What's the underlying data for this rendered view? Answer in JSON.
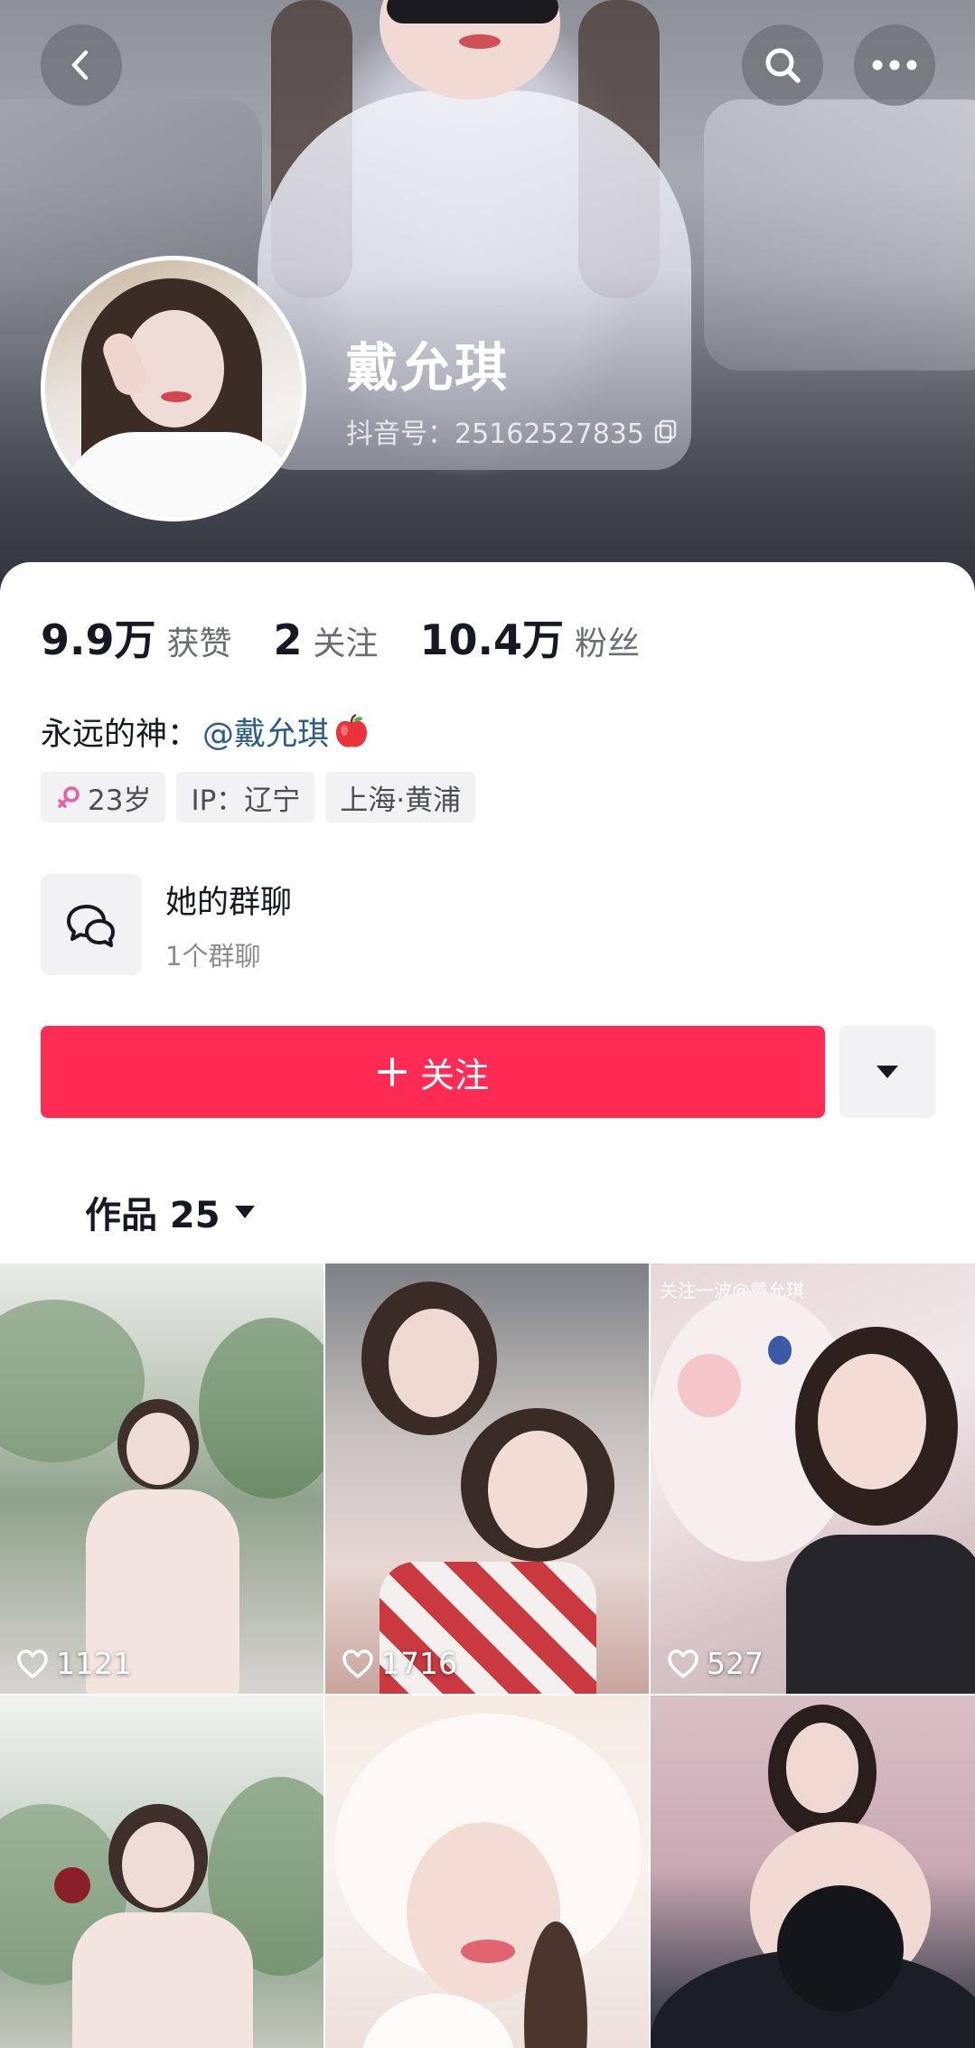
{
  "profile": {
    "name": "戴允琪",
    "douyin_id": "抖音号：25162527835"
  },
  "stats": [
    {
      "value": "9.9万",
      "label": "获赞"
    },
    {
      "value": "2",
      "label": "关注"
    },
    {
      "value": "10.4万",
      "label": "粉丝"
    }
  ],
  "bio": {
    "prefix": "永远的神：",
    "mention": "@戴允琪"
  },
  "tags": {
    "age": "23岁",
    "ip": "IP：辽宁",
    "location": "上海·黄浦"
  },
  "group_chat": {
    "title": "她的群聊",
    "subtitle": "1个群聊"
  },
  "follow_button": {
    "label": "关注"
  },
  "works_tab": {
    "label": "作品 25"
  },
  "videos": [
    {
      "likes": "1121"
    },
    {
      "likes": "1716"
    },
    {
      "likes": "527",
      "overlay_text": "关注一波@戴允琪"
    },
    {
      "likes": ""
    },
    {
      "likes": ""
    },
    {
      "likes": ""
    }
  ],
  "colors": {
    "follow_button": "#fe2c55",
    "link": "#2b5c8a",
    "gender_female": "#f05aa0"
  },
  "icons": [
    "back-icon",
    "search-icon",
    "more-icon",
    "copy-icon",
    "female-icon",
    "chat-bubbles-icon",
    "plus-icon",
    "caret-down-icon",
    "heart-icon",
    "apple-emoji-icon"
  ]
}
